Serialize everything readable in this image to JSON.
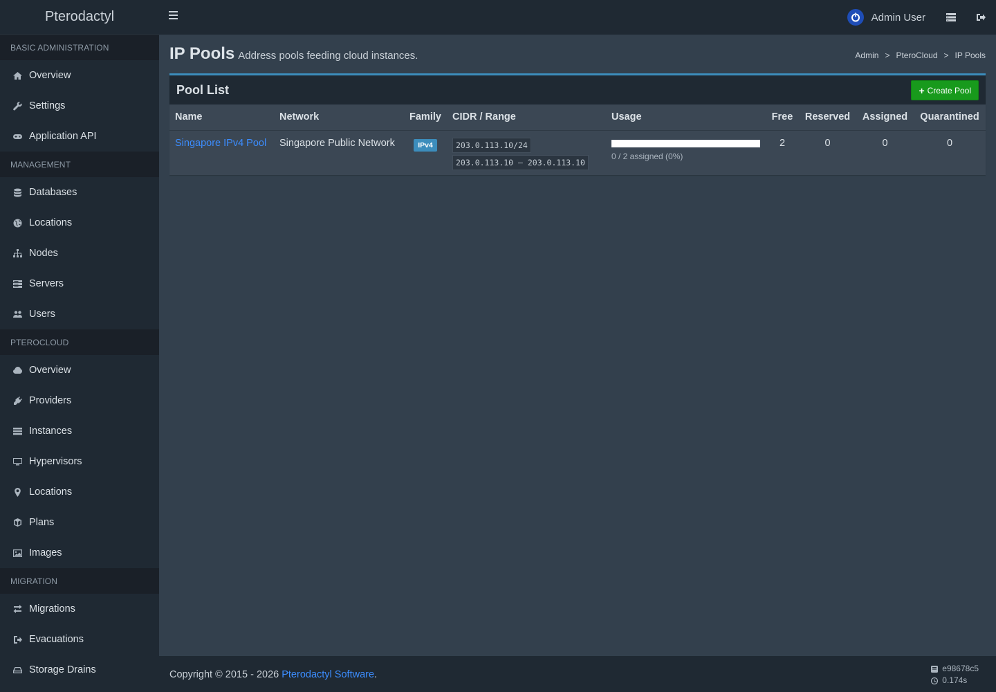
{
  "app": {
    "logo": "Pterodactyl"
  },
  "sidebar": {
    "sections": [
      {
        "header": "Basic Administration",
        "items": [
          {
            "label": "Overview",
            "icon": "home-icon"
          },
          {
            "label": "Settings",
            "icon": "wrench-icon"
          },
          {
            "label": "Application API",
            "icon": "gamepad-icon"
          }
        ]
      },
      {
        "header": "Management",
        "items": [
          {
            "label": "Databases",
            "icon": "database-icon"
          },
          {
            "label": "Locations",
            "icon": "globe-icon"
          },
          {
            "label": "Nodes",
            "icon": "sitemap-icon"
          },
          {
            "label": "Servers",
            "icon": "server-icon"
          },
          {
            "label": "Users",
            "icon": "users-icon"
          }
        ]
      },
      {
        "header": "PteroCloud",
        "items": [
          {
            "label": "Overview",
            "icon": "cloud-icon"
          },
          {
            "label": "Providers",
            "icon": "plug-icon"
          },
          {
            "label": "Instances",
            "icon": "list-icon"
          },
          {
            "label": "Hypervisors",
            "icon": "desktop-icon"
          },
          {
            "label": "Locations",
            "icon": "map-marker-icon"
          },
          {
            "label": "Plans",
            "icon": "cube-icon"
          },
          {
            "label": "Images",
            "icon": "image-icon"
          }
        ]
      },
      {
        "header": "Migration",
        "items": [
          {
            "label": "Migrations",
            "icon": "exchange-icon"
          },
          {
            "label": "Evacuations",
            "icon": "sign-out-icon"
          },
          {
            "label": "Storage Drains",
            "icon": "hdd-icon"
          }
        ]
      }
    ]
  },
  "topbar": {
    "user_name": "Admin User"
  },
  "header": {
    "title": "IP Pools",
    "subtitle": "Address pools feeding cloud instances.",
    "breadcrumb": [
      "Admin",
      "PteroCloud",
      "IP Pools"
    ],
    "breadcrumb_sep": ">"
  },
  "box": {
    "title": "Pool List",
    "create_label": "Create Pool",
    "columns": [
      "Name",
      "Network",
      "Family",
      "CIDR / Range",
      "Usage",
      "Free",
      "Reserved",
      "Assigned",
      "Quarantined"
    ],
    "rows": [
      {
        "name": "Singapore IPv4 Pool",
        "network": "Singapore Public Network",
        "family": "IPv4",
        "cidr": "203.0.113.10/24",
        "range": "203.0.113.10 – 203.0.113.10",
        "usage_fraction": 0,
        "usage_text": "0 / 2 assigned (0%)",
        "free": "2",
        "reserved": "0",
        "assigned": "0",
        "quarantined": "0"
      }
    ]
  },
  "footer": {
    "copyright_prefix": "Copyright © 2015 - 2026 ",
    "copyright_link": "Pterodactyl Software",
    "copyright_suffix": ".",
    "version": "e98678c5",
    "time": "0.174s"
  },
  "colors": {
    "accent": "#3c8dbc",
    "link": "#3c8dff",
    "success": "#189a1c",
    "sidebar_bg": "#1f2933",
    "content_bg": "#33404d"
  }
}
